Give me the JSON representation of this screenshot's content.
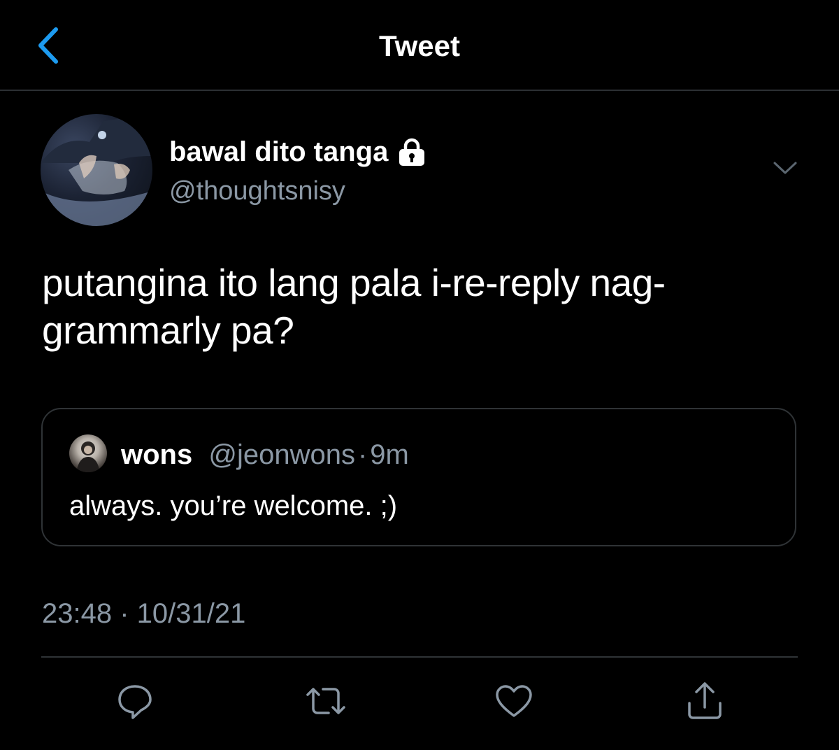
{
  "header": {
    "title": "Tweet",
    "back_icon": "chevron-left-icon"
  },
  "author": {
    "display_name": "bawal dito tanga",
    "handle": "@thoughtsnisy",
    "protected_icon": "lock-icon"
  },
  "tweet": {
    "text": "putangina ito lang pala i-re-reply nag-grammarly pa?",
    "timestamp": "23:48 · 10/31/21"
  },
  "quoted_tweet": {
    "name": "wons",
    "handle": "@jeonwons",
    "separator": "·",
    "time": "9m",
    "text": "always. you’re welcome. ;)"
  },
  "actions": [
    {
      "icon": "reply-icon"
    },
    {
      "icon": "retweet-icon"
    },
    {
      "icon": "like-icon"
    },
    {
      "icon": "share-icon"
    }
  ],
  "colors": {
    "background": "#000000",
    "accent": "#1d9bf0",
    "secondary_text": "#8b98a5",
    "border": "#2f3336"
  }
}
